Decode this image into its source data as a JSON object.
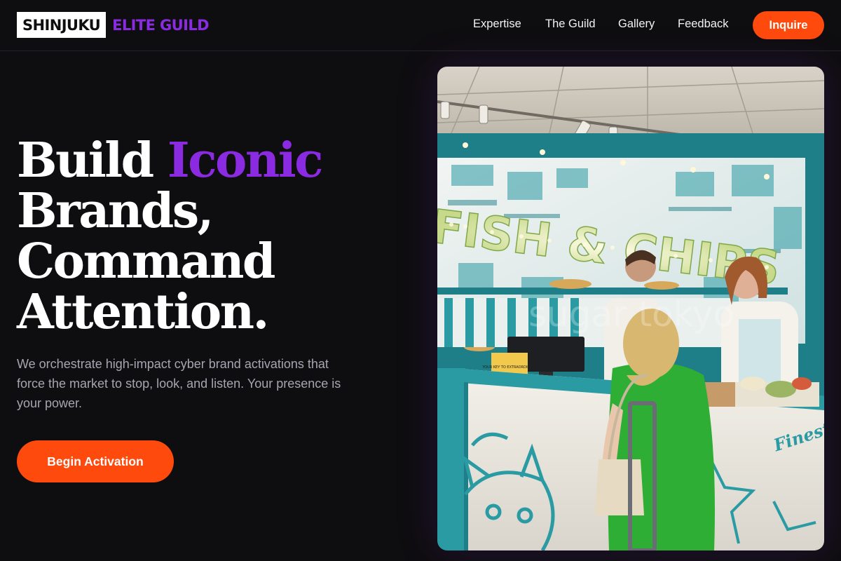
{
  "brand": {
    "primary": "SHINJUKU",
    "accent": "ELITE GUILD"
  },
  "nav": {
    "links": [
      "Expertise",
      "The Guild",
      "Gallery",
      "Feedback"
    ],
    "inquire_label": "Inquire"
  },
  "hero": {
    "headline_word_1": "Build",
    "headline_accent": "Iconic",
    "headline_line_2": "Brands,",
    "headline_line_3": "Command",
    "headline_line_4": "Attention.",
    "subtext": "We orchestrate high-impact cyber brand activations that force the market to stop, look, and listen. Your presence is your power.",
    "cta_label": "Begin Activation"
  },
  "photo": {
    "sign_text": "FISH & CHIPS",
    "counter_text": "Finest",
    "watermark": "sugar tokyo",
    "tent_card": "YOUR KEY TO EXTRAORDINARY"
  },
  "colors": {
    "background": "#0e0d0f",
    "accent_purple": "#8a2be2",
    "accent_orange": "#ff4a0d",
    "teal": "#2a9aa3"
  }
}
